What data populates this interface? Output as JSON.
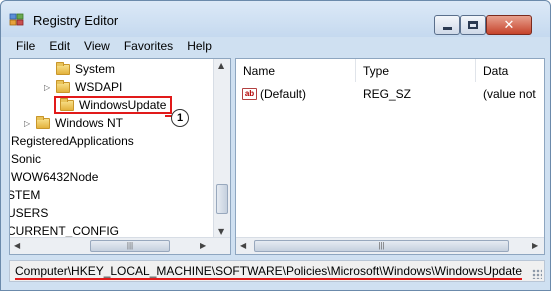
{
  "window": {
    "title": "Registry Editor"
  },
  "menu": [
    "File",
    "Edit",
    "View",
    "Favorites",
    "Help"
  ],
  "tree": {
    "items": [
      {
        "label": "System",
        "expander": ""
      },
      {
        "label": "WSDAPI",
        "expander": "▷"
      },
      {
        "label": "WindowsUpdate",
        "expander": ""
      },
      {
        "label": "Windows NT",
        "expander": "▷"
      },
      {
        "label": "RegisteredApplications",
        "expander": ""
      },
      {
        "label": "Sonic",
        "expander": ""
      },
      {
        "label": "WOW6432Node",
        "expander": ""
      },
      {
        "label": "STEM",
        "expander": ""
      },
      {
        "label": "USERS",
        "expander": ""
      },
      {
        "label": "CURRENT_CONFIG",
        "expander": ""
      }
    ],
    "callout": "1"
  },
  "list": {
    "columns": [
      "Name",
      "Type",
      "Data"
    ],
    "rows": [
      {
        "name": "(Default)",
        "type": "REG_SZ",
        "data": "(value not"
      }
    ]
  },
  "status": {
    "path": "Computer\\HKEY_LOCAL_MACHINE\\SOFTWARE\\Policies\\Microsoft\\Windows\\WindowsUpdate"
  },
  "icons": {
    "app": "registry-editor-icon",
    "folder": "folder-icon",
    "value": "string-value-icon"
  },
  "colors": {
    "highlight": "#e11a1a",
    "frame": "#cfe0f1"
  }
}
